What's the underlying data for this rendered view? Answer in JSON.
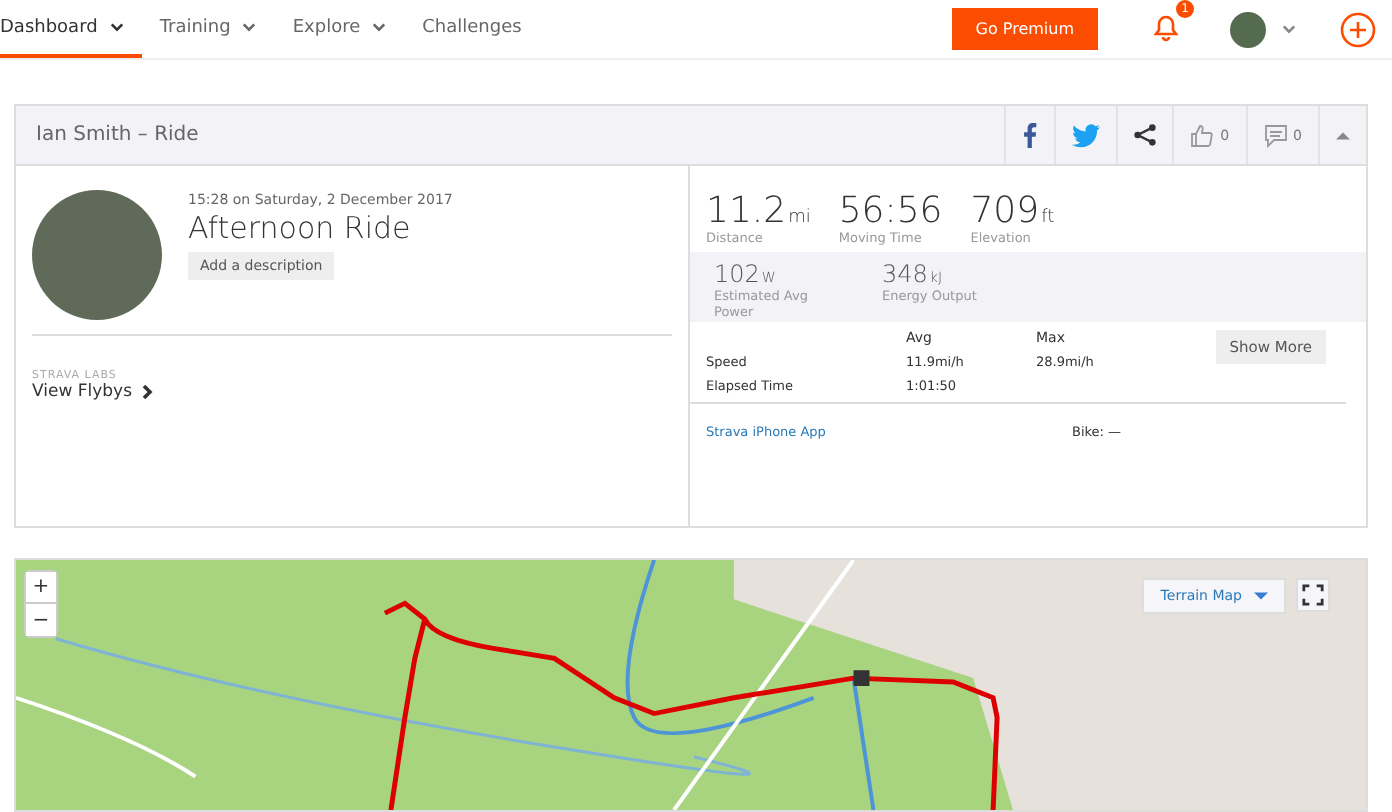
{
  "nav": {
    "items": [
      {
        "label": "Dashboard",
        "selected": true,
        "dropdown": true
      },
      {
        "label": "Training",
        "selected": false,
        "dropdown": true
      },
      {
        "label": "Explore",
        "selected": false,
        "dropdown": true
      },
      {
        "label": "Challenges",
        "selected": false,
        "dropdown": false
      }
    ],
    "premium_button": "Go Premium",
    "notification_count": "1"
  },
  "activity": {
    "title": "Ian Smith – Ride",
    "kudos_count": "0",
    "comment_count": "0",
    "datetime": "15:28 on Saturday, 2 December 2017",
    "name": "Afternoon Ride",
    "description_button": "Add a description",
    "labs_label": "STRAVA LABS",
    "flybys_link": "View Flybys",
    "primary_stats": [
      {
        "value": "11.2",
        "unit": "mi",
        "label": "Distance"
      },
      {
        "value": "56:56",
        "label": "Moving Time"
      },
      {
        "value": "709",
        "unit": "ft",
        "label": "Elevation"
      }
    ],
    "secondary_stats": [
      {
        "value": "102",
        "unit": "W",
        "label": "Estimated Avg Power"
      },
      {
        "value": "348",
        "unit": "kJ",
        "label": "Energy Output"
      }
    ],
    "table": {
      "columns": [
        "Avg",
        "Max"
      ],
      "rows": [
        {
          "label": "Speed",
          "avg": "11.9mi/h",
          "max": "28.9mi/h"
        },
        {
          "label": "Elapsed Time",
          "avg": "1:01:50"
        }
      ]
    },
    "show_more_button": "Show More",
    "device_link": "Strava iPhone App",
    "bike": "Bike: —"
  },
  "map": {
    "zoom_in": "+",
    "zoom_out": "−",
    "map_type": "Terrain Map"
  }
}
